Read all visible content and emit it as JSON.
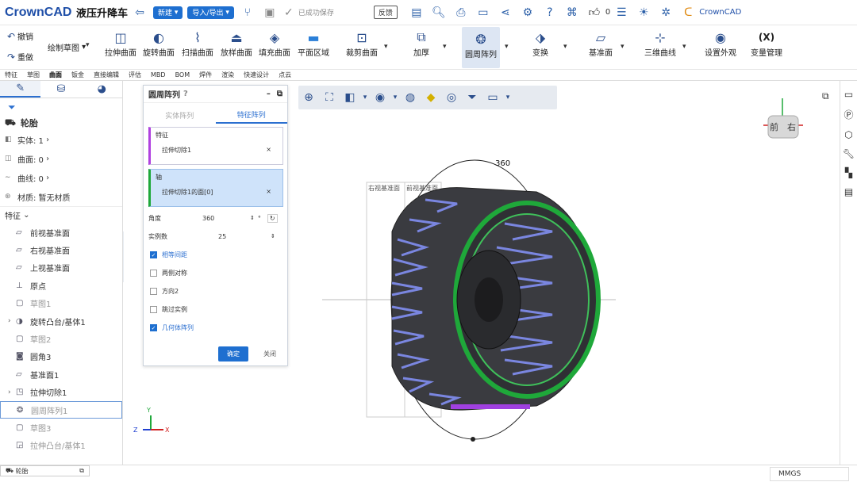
{
  "app": {
    "logo": "CrownCAD",
    "title": "液压升降车",
    "new_label": "新建",
    "import_label": "导入/导出",
    "saved_label": "已成功保存",
    "feedback_label": "反馈",
    "likes": "0",
    "brand": "CrownCAD"
  },
  "ribbon": {
    "undo": "撤销",
    "redo": "重做",
    "sketch": "绘制草图",
    "items": [
      "拉伸曲面",
      "旋转曲面",
      "扫描曲面",
      "放样曲面",
      "填充曲面",
      "平面区域",
      "裁剪曲面",
      "加厚",
      "圆周阵列",
      "变换",
      "基准面",
      "三维曲线",
      "设置外观",
      "变量管理"
    ],
    "var_icon": "(X)"
  },
  "menu": [
    "特征",
    "草图",
    "曲面",
    "钣金",
    "直接编辑",
    "评估",
    "MBD",
    "BOM",
    "焊件",
    "渲染",
    "快速设计",
    "点云"
  ],
  "menu_selected": "曲面",
  "left": {
    "part": "轮胎",
    "props": [
      {
        "label": "实体: 1"
      },
      {
        "label": "曲面: 0"
      },
      {
        "label": "曲线: 0"
      },
      {
        "label": "材质: 暂无材质"
      }
    ],
    "section": "特征",
    "tree": [
      {
        "label": "前视基准面",
        "state": "normal"
      },
      {
        "label": "右视基准面",
        "state": "normal"
      },
      {
        "label": "上视基准面",
        "state": "normal"
      },
      {
        "label": "原点",
        "state": "normal"
      },
      {
        "label": "草图1",
        "state": "gray"
      },
      {
        "label": "旋转凸台/基体1",
        "state": "normal"
      },
      {
        "label": "草图2",
        "state": "gray"
      },
      {
        "label": "圆角3",
        "state": "normal"
      },
      {
        "label": "基准面1",
        "state": "normal"
      },
      {
        "label": "拉伸切除1",
        "state": "normal"
      },
      {
        "label": "圆周阵列1",
        "state": "sel"
      },
      {
        "label": "草图3",
        "state": "gray"
      },
      {
        "label": "拉伸凸台/基体1",
        "state": "gray"
      }
    ]
  },
  "panel": {
    "title": "圆周阵列",
    "tab1": "实体阵列",
    "tab2": "特征阵列",
    "feature_label": "特征",
    "feature_value": "拉伸切除1",
    "axis_label": "轴",
    "axis_value": "拉伸切除1的面[0]",
    "angle_label": "角度",
    "angle_value": "360",
    "angle_unit": "°",
    "count_label": "实例数",
    "count_value": "25",
    "opts": [
      {
        "label": "相等间距",
        "on": true
      },
      {
        "label": "两侧对称",
        "on": false
      },
      {
        "label": "方向2",
        "on": false
      },
      {
        "label": "跳过实例",
        "on": false
      },
      {
        "label": "几何体阵列",
        "on": true
      }
    ],
    "ok": "确定",
    "close": "关闭"
  },
  "viewport": {
    "dim_label": "360",
    "front_label": "右视基准面",
    "back_label": "前视基准面",
    "cube_front": "前",
    "cube_right": "右"
  },
  "status": {
    "tab": "轮胎",
    "units": "MMGS"
  }
}
